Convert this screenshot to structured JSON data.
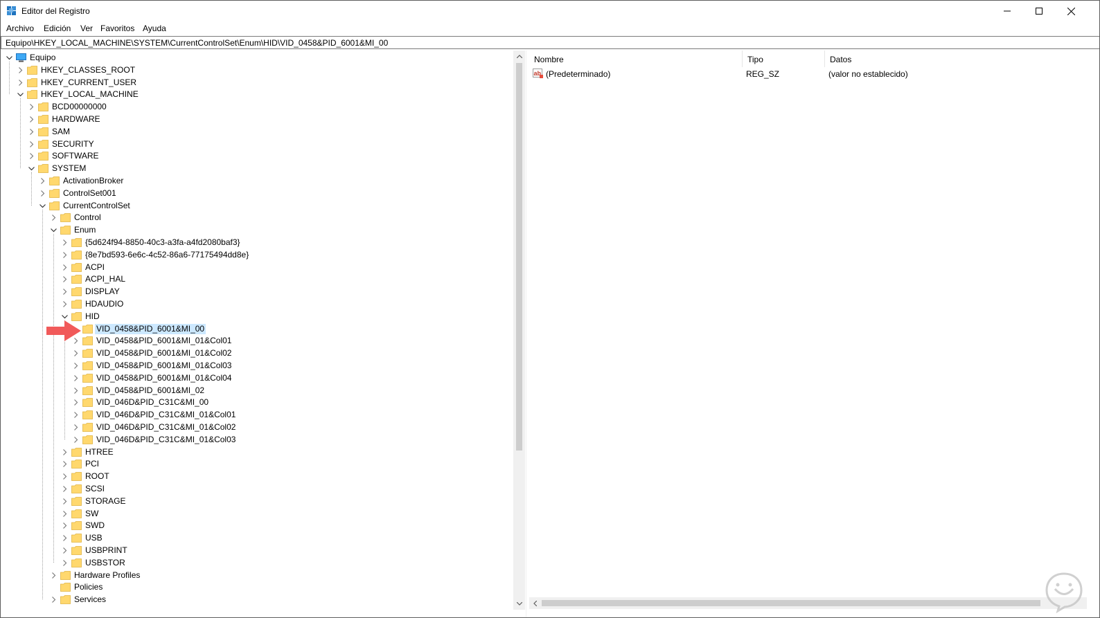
{
  "window": {
    "title": "Editor del Registro"
  },
  "menu": [
    "Archivo",
    "Edición",
    "Ver",
    "Favoritos",
    "Ayuda"
  ],
  "address": "Equipo\\HKEY_LOCAL_MACHINE\\SYSTEM\\CurrentControlSet\\Enum\\HID\\VID_0458&PID_6001&MI_00",
  "tree": [
    {
      "label": "Equipo",
      "depth": 0,
      "expander": "open",
      "icon": "computer-icon"
    },
    {
      "label": "HKEY_CLASSES_ROOT",
      "depth": 1,
      "expander": "closed"
    },
    {
      "label": "HKEY_CURRENT_USER",
      "depth": 1,
      "expander": "closed"
    },
    {
      "label": "HKEY_LOCAL_MACHINE",
      "depth": 1,
      "expander": "open"
    },
    {
      "label": "BCD00000000",
      "depth": 2,
      "expander": "closed"
    },
    {
      "label": "HARDWARE",
      "depth": 2,
      "expander": "closed"
    },
    {
      "label": "SAM",
      "depth": 2,
      "expander": "closed"
    },
    {
      "label": "SECURITY",
      "depth": 2,
      "expander": "closed"
    },
    {
      "label": "SOFTWARE",
      "depth": 2,
      "expander": "closed"
    },
    {
      "label": "SYSTEM",
      "depth": 2,
      "expander": "open"
    },
    {
      "label": "ActivationBroker",
      "depth": 3,
      "expander": "closed"
    },
    {
      "label": "ControlSet001",
      "depth": 3,
      "expander": "closed"
    },
    {
      "label": "CurrentControlSet",
      "depth": 3,
      "expander": "open"
    },
    {
      "label": "Control",
      "depth": 4,
      "expander": "closed"
    },
    {
      "label": "Enum",
      "depth": 4,
      "expander": "open"
    },
    {
      "label": "{5d624f94-8850-40c3-a3fa-a4fd2080baf3}",
      "depth": 5,
      "expander": "closed"
    },
    {
      "label": "{8e7bd593-6e6c-4c52-86a6-77175494dd8e}",
      "depth": 5,
      "expander": "closed"
    },
    {
      "label": "ACPI",
      "depth": 5,
      "expander": "closed"
    },
    {
      "label": "ACPI_HAL",
      "depth": 5,
      "expander": "closed"
    },
    {
      "label": "DISPLAY",
      "depth": 5,
      "expander": "closed"
    },
    {
      "label": "HDAUDIO",
      "depth": 5,
      "expander": "closed"
    },
    {
      "label": "HID",
      "depth": 5,
      "expander": "open"
    },
    {
      "label": "VID_0458&PID_6001&MI_00",
      "depth": 6,
      "expander": "none",
      "selected": true
    },
    {
      "label": "VID_0458&PID_6001&MI_01&Col01",
      "depth": 6,
      "expander": "closed"
    },
    {
      "label": "VID_0458&PID_6001&MI_01&Col02",
      "depth": 6,
      "expander": "closed"
    },
    {
      "label": "VID_0458&PID_6001&MI_01&Col03",
      "depth": 6,
      "expander": "closed"
    },
    {
      "label": "VID_0458&PID_6001&MI_01&Col04",
      "depth": 6,
      "expander": "closed"
    },
    {
      "label": "VID_0458&PID_6001&MI_02",
      "depth": 6,
      "expander": "closed"
    },
    {
      "label": "VID_046D&PID_C31C&MI_00",
      "depth": 6,
      "expander": "closed"
    },
    {
      "label": "VID_046D&PID_C31C&MI_01&Col01",
      "depth": 6,
      "expander": "closed"
    },
    {
      "label": "VID_046D&PID_C31C&MI_01&Col02",
      "depth": 6,
      "expander": "closed"
    },
    {
      "label": "VID_046D&PID_C31C&MI_01&Col03",
      "depth": 6,
      "expander": "closed"
    },
    {
      "label": "HTREE",
      "depth": 5,
      "expander": "closed"
    },
    {
      "label": "PCI",
      "depth": 5,
      "expander": "closed"
    },
    {
      "label": "ROOT",
      "depth": 5,
      "expander": "closed"
    },
    {
      "label": "SCSI",
      "depth": 5,
      "expander": "closed"
    },
    {
      "label": "STORAGE",
      "depth": 5,
      "expander": "closed"
    },
    {
      "label": "SW",
      "depth": 5,
      "expander": "closed"
    },
    {
      "label": "SWD",
      "depth": 5,
      "expander": "closed"
    },
    {
      "label": "USB",
      "depth": 5,
      "expander": "closed"
    },
    {
      "label": "USBPRINT",
      "depth": 5,
      "expander": "closed"
    },
    {
      "label": "USBSTOR",
      "depth": 5,
      "expander": "closed"
    },
    {
      "label": "Hardware Profiles",
      "depth": 4,
      "expander": "closed"
    },
    {
      "label": "Policies",
      "depth": 4,
      "expander": "none"
    },
    {
      "label": "Services",
      "depth": 4,
      "expander": "closed"
    }
  ],
  "list": {
    "columns": [
      "Nombre",
      "Tipo",
      "Datos"
    ],
    "rows": [
      {
        "name": "(Predeterminado)",
        "type": "REG_SZ",
        "data": "(valor no establecido)",
        "icon": "string-value-icon"
      }
    ]
  },
  "colors": {
    "selection": "#cce8ff",
    "folder": "#ffd86e",
    "arrow": "#f15a5a",
    "accent": "#0078d7"
  }
}
